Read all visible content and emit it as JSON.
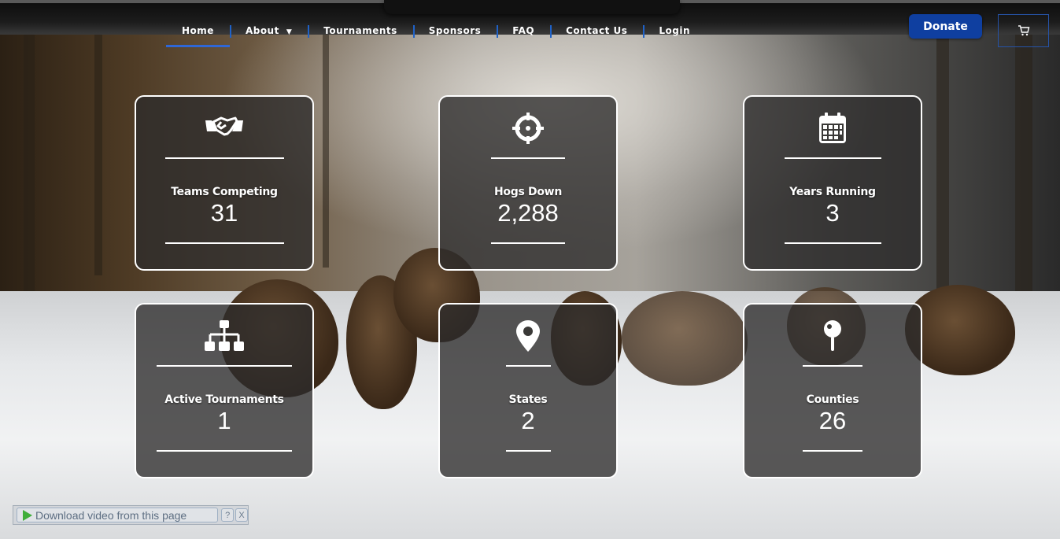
{
  "nav": {
    "items": [
      {
        "label": "Home",
        "active": true
      },
      {
        "label": "About",
        "has_dropdown": true
      },
      {
        "label": "Tournaments"
      },
      {
        "label": "Sponsors"
      },
      {
        "label": "FAQ"
      },
      {
        "label": "Contact Us"
      },
      {
        "label": "Login"
      }
    ],
    "donate_label": "Donate",
    "cart_icon": "cart-icon"
  },
  "stats": [
    {
      "label": "Teams Competing",
      "value": "31",
      "icon": "handshake-icon"
    },
    {
      "label": "Hogs Down",
      "value": "2,288",
      "icon": "crosshairs-icon"
    },
    {
      "label": "Years Running",
      "value": "3",
      "icon": "calendar-icon"
    },
    {
      "label": "Active Tournaments",
      "value": "1",
      "icon": "sitemap-icon"
    },
    {
      "label": "States",
      "value": "2",
      "icon": "map-marker-icon"
    },
    {
      "label": "Counties",
      "value": "26",
      "icon": "map-pin-icon"
    }
  ],
  "download_bar": {
    "label": "Download video from this page",
    "help": "?",
    "close": "X"
  },
  "colors": {
    "accent": "#1f62c8",
    "donate_bg": "#0f3fa0",
    "card_bg": "#2d2c2b"
  }
}
